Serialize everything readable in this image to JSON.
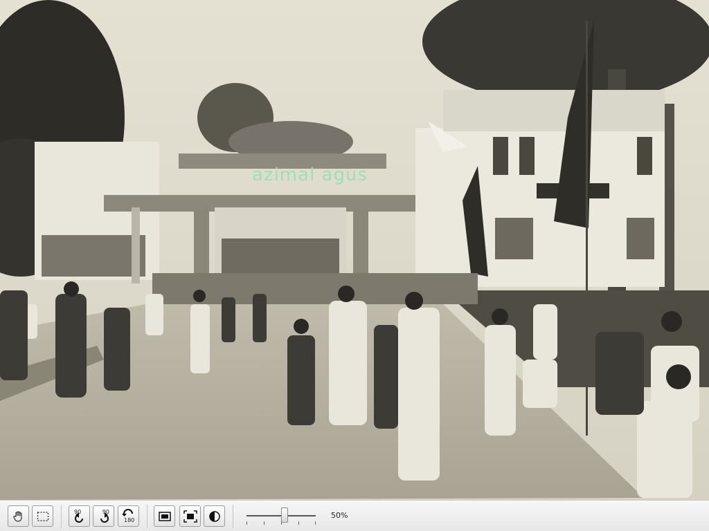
{
  "photo": {
    "description_icon": "sepia-street-photo",
    "watermark_text": "azimal agus"
  },
  "toolbar": {
    "buttons": [
      {
        "name": "pan-tool-button",
        "icon": "hand-icon"
      },
      {
        "name": "selection-tool-button",
        "icon": "marquee-select-icon"
      },
      {
        "name": "rotate-left-90-button",
        "icon": "rotate-ccw-icon",
        "label": "90"
      },
      {
        "name": "rotate-right-90-button",
        "icon": "rotate-cw-icon",
        "label": "90"
      },
      {
        "name": "rotate-180-button",
        "icon": "rotate-180-icon",
        "label": "180"
      },
      {
        "name": "actual-size-button",
        "icon": "image-frame-icon"
      },
      {
        "name": "fit-screen-button",
        "icon": "fit-to-screen-icon"
      },
      {
        "name": "contrast-button",
        "icon": "contrast-icon"
      }
    ],
    "zoom": {
      "value": 0.5,
      "label": "50%"
    }
  },
  "colors": {
    "toolbar_bg": "#ececec",
    "watermark": "#8fe3b3",
    "sepia_sky": "#e2dfd1"
  }
}
